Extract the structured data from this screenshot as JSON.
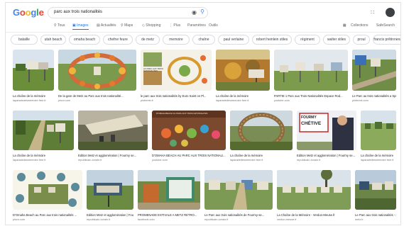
{
  "search": {
    "query": "parc aux trois nationalités"
  },
  "logo": {
    "text": "Google"
  },
  "tabs": [
    "Tous",
    "Images",
    "Actualités",
    "Maps",
    "Shopping",
    "Plus",
    "Paramètres",
    "Outils"
  ],
  "tools": {
    "collections": "Collections",
    "safesearch": "SafeSearch"
  },
  "chips": [
    "bataille",
    "utah beach",
    "omaha beach",
    "chefne feure",
    "de metz",
    "memoire",
    "chaîne",
    "paul verlaine",
    "robert heinlein stiles",
    "régiment",
    "walter stiles",
    "proul",
    "francis prêtinnenage"
  ],
  "results": [
    {
      "caption": "La chaîne de la mémoire",
      "source": "laparadedesmemoire.free.fr"
    },
    {
      "caption": "De la gare de Metz au Parc aux trois nationalité...",
      "source": "piscn.com"
    },
    {
      "caption": "le parc aux trois nationalités by Euro Saint on Pl...",
      "source": "pinterest.fr"
    },
    {
      "caption": "La chaîne de la mémoire",
      "source": "laparadedesmemoire.free.fr"
    },
    {
      "caption": "PARTIE 1 Parc aux Trois Nationalités Espace Rod...",
      "source": "youtube.com"
    },
    {
      "caption": "Le Parc au trois nationalités a Spicheren",
      "source": "pinterest.com"
    },
    {
      "caption": "La chaîne de la mémoire",
      "source": "laparadedesmemoire.free.fr"
    },
    {
      "caption": "Edition Metz et agglomération | Fourmy se...",
      "source": "republicain-lorrain.fr"
    },
    {
      "caption": "D'OMAHA BEACH AU PARC AUX TROIS NATIONALI...",
      "source": "youtube.com"
    },
    {
      "caption": "La chaîne de la mémoire",
      "source": "laparadedesmemoire.free.fr"
    },
    {
      "caption": "Edition Metz et agglomération | Fourmy se...",
      "source": "republicain-lorrain.fr"
    },
    {
      "caption": "La chaîne de la mémoire",
      "source": "laparadedesmemoire.free.fr"
    },
    {
      "caption": "D'Omaha Beach au Parc aux trois nationalités ...",
      "source": "piscn.com"
    },
    {
      "caption": "Edition Metz et agglomération | Fourmy se...",
      "source": "republicain-lorrain.fr"
    },
    {
      "caption": "PROMENADE ESTIVALE A METZ RETRO...",
      "source": "facebook.com"
    },
    {
      "caption": "Le Parc aux trois nationalités de Fourmy-se...",
      "source": "republicain-lorrain.fr"
    },
    {
      "caption": "La Chaîne de la Mémoire - Verdun-Meuse.fr",
      "source": "verdun-meuse.fr"
    },
    {
      "caption": "Le Parc aux trois nationalités - Espace Rob...",
      "source": "metz.fr"
    }
  ],
  "image_texts": {
    "r1_sign": "AU PARC AUX TROIS NATIONALITES",
    "r2_sign": "D'OMAHA BEACH AU PARC AUX TROIS NATIONALITES",
    "r2_fourmy": "FOURMY",
    "r2_chetive": "CHÉTIVE"
  },
  "colors": {
    "accent": "#1a73e8",
    "google_blue": "#4285f4",
    "google_red": "#ea4335",
    "google_yellow": "#fbbc05",
    "google_green": "#34a853"
  }
}
